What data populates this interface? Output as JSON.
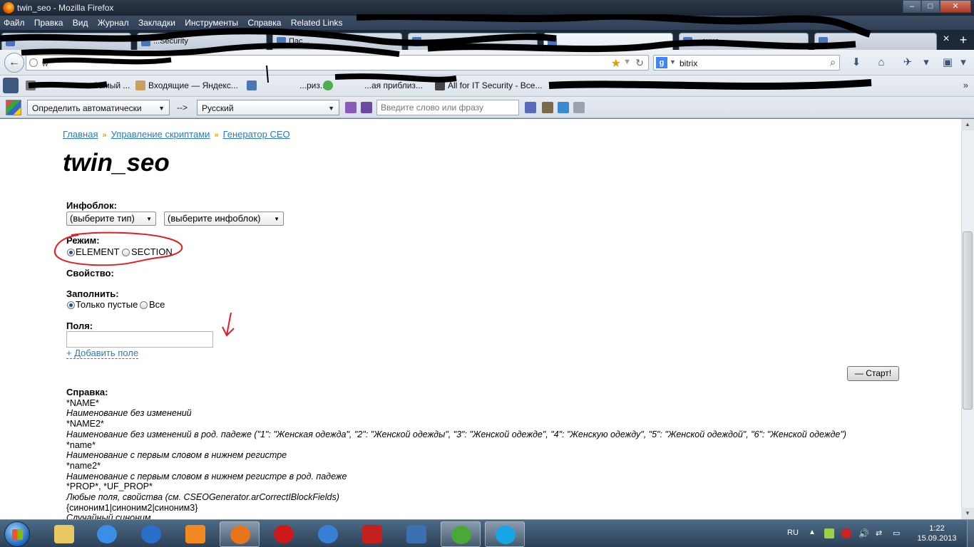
{
  "window": {
    "title": "twin_seo - Mozilla Firefox",
    "controls": [
      "–",
      "□",
      "✕"
    ]
  },
  "menu": [
    "Файл",
    "Правка",
    "Вид",
    "Журнал",
    "Закладки",
    "Инструменты",
    "Справка",
    "Related Links"
  ],
  "tabs": [
    {
      "label": ""
    },
    {
      "label": "...Security"
    },
    {
      "label": "Пас..."
    },
    {
      "label": ""
    },
    {
      "label": ""
    },
    {
      "label": "...ение"
    },
    {
      "label": ""
    }
  ],
  "navbar": {
    "url": "w",
    "search_value": "bitrix",
    "search_engine": "g"
  },
  "bookmarks": [
    {
      "label": "Самый ...",
      "icon_color": "#777777"
    },
    {
      "label": "Входящие — Яндекс...",
      "icon_color": "#c8a060"
    },
    {
      "label": "...риз...",
      "icon_color": "#4a76b8"
    },
    {
      "label": "...ая приблиз...",
      "icon_color": "#4cae4c"
    },
    {
      "label": "All for IT Security - Все...",
      "icon_color": "#444444"
    }
  ],
  "translator": {
    "source_lang": "Определить автоматически",
    "arrow": "-->",
    "target_lang": "Русский",
    "input_placeholder": "Введите слово или фразу"
  },
  "breadcrumb": {
    "items": [
      "Главная",
      "Управление скриптами",
      "Генератор СЕО"
    ],
    "separator": "»"
  },
  "page": {
    "title": "twin_seo",
    "iblock_label": "Инфоблок:",
    "iblock_type": "(выберите тип)",
    "iblock_select": "(выберите инфоблок)",
    "mode_label": "Режим:",
    "mode_element": "ELEMENT",
    "mode_section": "SECTION",
    "property_label": "Свойство:",
    "fill_label": "Заполнить:",
    "fill_empty": "Только пустые",
    "fill_all": "Все",
    "fields_label": "Поля:",
    "add_field": "+ Добавить поле",
    "start_button": "— Старт!"
  },
  "help": {
    "title": "Справка:",
    "lines": [
      {
        "code": "*NAME*",
        "desc": "Наименование без изменений"
      },
      {
        "code": "*NAME2*",
        "desc": "Наименование без изменений в род. падеже (\"1\": \"Женская одежда\", \"2\": \"Женской одежды\", \"3\": \"Женской одежде\", \"4\": \"Женскую одежду\", \"5\": \"Женской одеждой\", \"6\": \"Женской одежде\")"
      },
      {
        "code": "*name*",
        "desc": "Наименование с первым словом в нижнем регистре"
      },
      {
        "code": "*name2*",
        "desc": "Наименование с первым словом в нижнем регистре в род. падеже"
      },
      {
        "code": "*PROP*, *UF_PROP*",
        "desc": "Любые поля, свойства (см. CSEOGenerator.arCorrectIBlockFields)"
      },
      {
        "code": "{синоним1|синоним2|синоним3}",
        "desc": "Случайный синоним"
      }
    ]
  },
  "taskbar": {
    "language": "RU",
    "time": "1:22",
    "date": "15.09.2013",
    "apps": [
      {
        "name": "explorer",
        "color": "#e8c860"
      },
      {
        "name": "internet-explorer",
        "color": "#3a8ee6"
      },
      {
        "name": "lightning-app",
        "color": "#2a6fc9"
      },
      {
        "name": "media-player",
        "color": "#f08a20"
      },
      {
        "name": "firefox",
        "color": "#e8751a"
      },
      {
        "name": "opera",
        "color": "#cc1a1a"
      },
      {
        "name": "mail",
        "color": "#3a7fd6"
      },
      {
        "name": "filezilla",
        "color": "#c42020"
      },
      {
        "name": "sublime",
        "color": "#3a6fb0"
      },
      {
        "name": "utorrent",
        "color": "#4aa83a"
      },
      {
        "name": "skype",
        "color": "#17a6e4"
      }
    ]
  },
  "colors": {
    "link": "#2c7bb9",
    "breadcrumb_sep": "#e4a800",
    "annotation": "#e02020"
  }
}
